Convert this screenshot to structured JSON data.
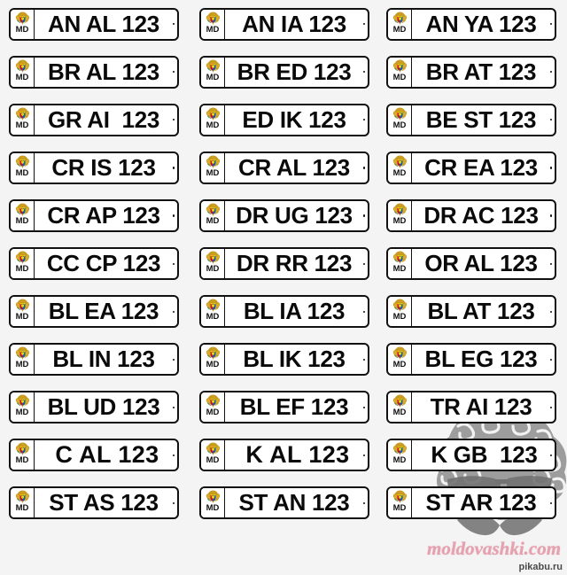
{
  "page": {
    "title": "Moldova License Plate Sheet",
    "background_color": "#f4f4f4",
    "columns": 3,
    "rows": 12,
    "plate_count": 36
  },
  "plate_common": {
    "country_code": "MD",
    "emblem_name": "moldova-coat-of-arms",
    "emblem_colors": [
      "#b8860b",
      "#c8102e",
      "#0072ce",
      "#ffd100",
      "#1f7a3f"
    ],
    "plate_background": "#ffffff",
    "plate_border_color": "#111111",
    "text_color": "#0a0a0a",
    "serial_suffix": "123"
  },
  "watermarks": {
    "site_text": "moldovashki.com",
    "site_color": "#e7a0ae",
    "source_text": "pikabu.ru",
    "source_color": "#4a4a4a",
    "face_name": "curly-hair-sunglasses-mustache-face",
    "face_color": "#8c8c8c"
  },
  "plates": [
    {
      "row": 1,
      "col": 1,
      "code": "MD",
      "number": "AN AL 123",
      "prefix": "AN",
      "letters": "AL",
      "digits": "123"
    },
    {
      "row": 1,
      "col": 2,
      "code": "MD",
      "number": "AN IA 123",
      "prefix": "AN",
      "letters": "IA",
      "digits": "123"
    },
    {
      "row": 1,
      "col": 3,
      "code": "MD",
      "number": "AN YA 123",
      "prefix": "AN",
      "letters": "YA",
      "digits": "123"
    },
    {
      "row": 2,
      "col": 1,
      "code": "MD",
      "number": "BR AL 123",
      "prefix": "BR",
      "letters": "AL",
      "digits": "123"
    },
    {
      "row": 2,
      "col": 2,
      "code": "MD",
      "number": "BR ED 123",
      "prefix": "BR",
      "letters": "ED",
      "digits": "123"
    },
    {
      "row": 2,
      "col": 3,
      "code": "MD",
      "number": "BR AT 123",
      "prefix": "BR",
      "letters": "AT",
      "digits": "123"
    },
    {
      "row": 3,
      "col": 1,
      "code": "MD",
      "number": "GR AI  123",
      "prefix": "GR",
      "letters": "AI",
      "digits": "123"
    },
    {
      "row": 3,
      "col": 2,
      "code": "MD",
      "number": "ED IK 123",
      "prefix": "ED",
      "letters": "IK",
      "digits": "123"
    },
    {
      "row": 3,
      "col": 3,
      "code": "MD",
      "number": "BE ST 123",
      "prefix": "BE",
      "letters": "ST",
      "digits": "123"
    },
    {
      "row": 4,
      "col": 1,
      "code": "MD",
      "number": "CR IS 123",
      "prefix": "CR",
      "letters": "IS",
      "digits": "123"
    },
    {
      "row": 4,
      "col": 2,
      "code": "MD",
      "number": "CR AL 123",
      "prefix": "CR",
      "letters": "AL",
      "digits": "123"
    },
    {
      "row": 4,
      "col": 3,
      "code": "MD",
      "number": "CR EA 123",
      "prefix": "CR",
      "letters": "EA",
      "digits": "123"
    },
    {
      "row": 5,
      "col": 1,
      "code": "MD",
      "number": "CR AP 123",
      "prefix": "CR",
      "letters": "AP",
      "digits": "123"
    },
    {
      "row": 5,
      "col": 2,
      "code": "MD",
      "number": "DR UG 123",
      "prefix": "DR",
      "letters": "UG",
      "digits": "123"
    },
    {
      "row": 5,
      "col": 3,
      "code": "MD",
      "number": "DR AC 123",
      "prefix": "DR",
      "letters": "AC",
      "digits": "123"
    },
    {
      "row": 6,
      "col": 1,
      "code": "MD",
      "number": "CC CP 123",
      "prefix": "CC",
      "letters": "CP",
      "digits": "123"
    },
    {
      "row": 6,
      "col": 2,
      "code": "MD",
      "number": "DR RR 123",
      "prefix": "DR",
      "letters": "RR",
      "digits": "123"
    },
    {
      "row": 6,
      "col": 3,
      "code": "MD",
      "number": "OR AL 123",
      "prefix": "OR",
      "letters": "AL",
      "digits": "123"
    },
    {
      "row": 7,
      "col": 1,
      "code": "MD",
      "number": "BL EA 123",
      "prefix": "BL",
      "letters": "EA",
      "digits": "123"
    },
    {
      "row": 7,
      "col": 2,
      "code": "MD",
      "number": "BL IA 123",
      "prefix": "BL",
      "letters": "IA",
      "digits": "123"
    },
    {
      "row": 7,
      "col": 3,
      "code": "MD",
      "number": "BL AT 123",
      "prefix": "BL",
      "letters": "AT",
      "digits": "123"
    },
    {
      "row": 8,
      "col": 1,
      "code": "MD",
      "number": "BL IN 123",
      "prefix": "BL",
      "letters": "IN",
      "digits": "123"
    },
    {
      "row": 8,
      "col": 2,
      "code": "MD",
      "number": "BL IK 123",
      "prefix": "BL",
      "letters": "IK",
      "digits": "123"
    },
    {
      "row": 8,
      "col": 3,
      "code": "MD",
      "number": "BL EG 123",
      "prefix": "BL",
      "letters": "EG",
      "digits": "123"
    },
    {
      "row": 9,
      "col": 1,
      "code": "MD",
      "number": "BL UD 123",
      "prefix": "BL",
      "letters": "UD",
      "digits": "123"
    },
    {
      "row": 9,
      "col": 2,
      "code": "MD",
      "number": "BL EF 123",
      "prefix": "BL",
      "letters": "EF",
      "digits": "123"
    },
    {
      "row": 9,
      "col": 3,
      "code": "MD",
      "number": "TR AI 123",
      "prefix": "TR",
      "letters": "AI",
      "digits": "123"
    },
    {
      "row": 10,
      "col": 1,
      "code": "MD",
      "number": " C AL 123",
      "prefix": "C",
      "letters": "AL",
      "digits": "123"
    },
    {
      "row": 10,
      "col": 2,
      "code": "MD",
      "number": " K AL 123",
      "prefix": "K",
      "letters": "AL",
      "digits": "123"
    },
    {
      "row": 10,
      "col": 3,
      "code": "MD",
      "number": " K GB  123",
      "prefix": "K",
      "letters": "GB",
      "digits": "123"
    },
    {
      "row": 11,
      "col": 1,
      "code": "MD",
      "number": "ST AS 123",
      "prefix": "ST",
      "letters": "AS",
      "digits": "123"
    },
    {
      "row": 11,
      "col": 2,
      "code": "MD",
      "number": "ST AN 123",
      "prefix": "ST",
      "letters": "AN",
      "digits": "123"
    },
    {
      "row": 11,
      "col": 3,
      "code": "MD",
      "number": "ST AR 123",
      "prefix": "ST",
      "letters": "AR",
      "digits": "123"
    }
  ]
}
